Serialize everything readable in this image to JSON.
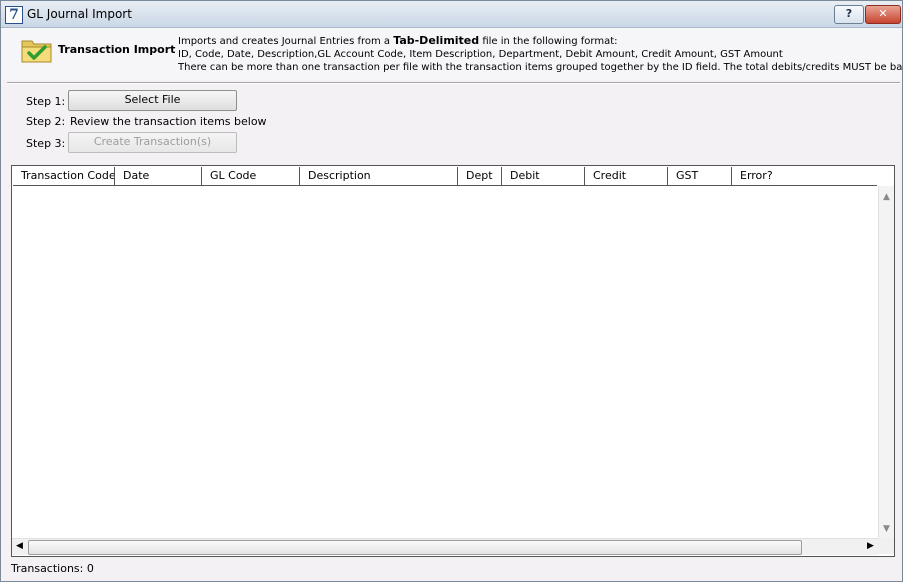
{
  "window": {
    "title": "GL Journal Import",
    "app_icon": "7",
    "help_label": "?",
    "close_label": "✕"
  },
  "header": {
    "heading": "Transaction Import",
    "desc_prefix": "Imports and creates Journal Entries from a ",
    "desc_bold": "Tab-Delimited",
    "desc_suffix": " file in the following format:",
    "format_line": "ID, Code, Date, Description,GL Account Code, Item Description, Department, Debit Amount, Credit Amount, GST Amount",
    "note_line": "There can be more than one transaction per file with the transaction items grouped together by the ID field. The total debits/credits MUST be balanced"
  },
  "steps": {
    "step1_label": "Step 1:",
    "step1_button": "Select File",
    "step2_label": "Step 2:",
    "step2_text": "Review the transaction items below",
    "step3_label": "Step 3:",
    "step3_button": "Create Transaction(s)"
  },
  "table": {
    "columns": [
      "Transaction Code",
      "Date",
      "GL Code",
      "Description",
      "Dept",
      "Debit",
      "Credit",
      "GST",
      "Error?"
    ],
    "rows": []
  },
  "status": {
    "text": "Transactions: 0"
  },
  "colors": {
    "titlebar_top": "#e9eef4",
    "close_button": "#c84530",
    "checkmark": "#2e9c2e",
    "folder": "#e5c65a"
  }
}
